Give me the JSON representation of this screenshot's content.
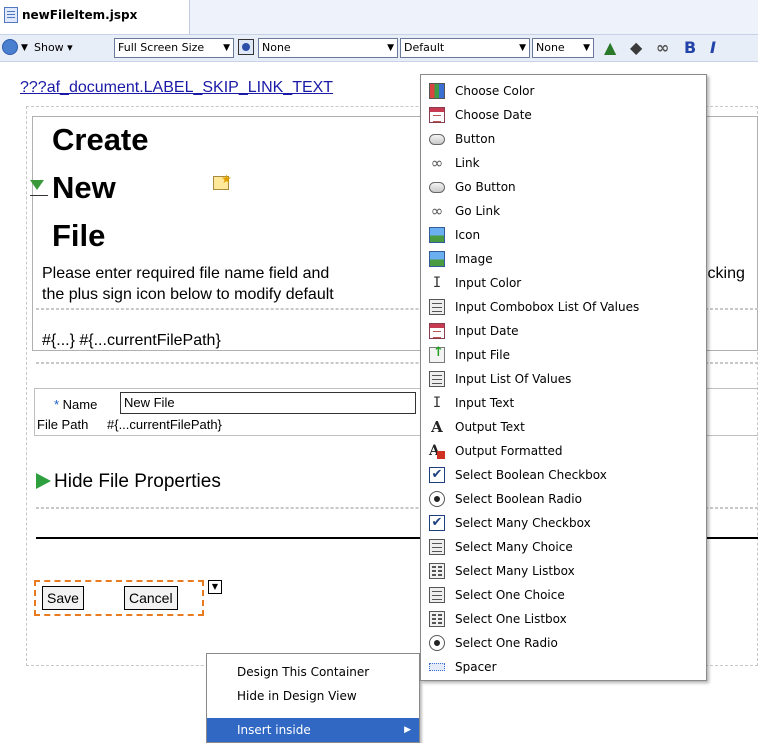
{
  "editor_tab": {
    "title": "newFileItem.jspx"
  },
  "toolbar": {
    "show_label": "Show",
    "screen_size": "Full Screen Size",
    "skin": "None",
    "style": "Default",
    "class": "None",
    "bold": "B",
    "italic": "I"
  },
  "page": {
    "skip_link": "???af_document.LABEL_SKIP_LINK_TEXT",
    "title_lines": [
      "Create",
      "New",
      "File"
    ],
    "instructions_line1": "Please enter required file name field and",
    "instructions_line1_tail": "icking",
    "instructions_line2": "the plus sign icon below to modify default",
    "path_expr": "#{...} #{...currentFilePath}",
    "name_label": "Name",
    "name_value": "New File",
    "file_path_label": "File Path",
    "file_path_value": "#{...currentFilePath}",
    "hide_props": "Hide File Properties",
    "save_button": "Save",
    "cancel_button": "Cancel"
  },
  "context_menu": {
    "items": [
      "Design This Container",
      "Hide in Design View",
      "Insert inside"
    ]
  },
  "insert_menu": {
    "items": [
      {
        "label": "Choose Color",
        "icon": "color-grid-icon"
      },
      {
        "label": "Choose Date",
        "icon": "calendar-icon"
      },
      {
        "label": "Button",
        "icon": "button-icon"
      },
      {
        "label": "Link",
        "icon": "link-icon"
      },
      {
        "label": "Go Button",
        "icon": "button-icon"
      },
      {
        "label": "Go Link",
        "icon": "link-icon"
      },
      {
        "label": "Icon",
        "icon": "image-icon"
      },
      {
        "label": "Image",
        "icon": "image-icon"
      },
      {
        "label": "Input Color",
        "icon": "text-cursor-icon"
      },
      {
        "label": "Input Combobox List Of Values",
        "icon": "list-icon"
      },
      {
        "label": "Input Date",
        "icon": "calendar-icon"
      },
      {
        "label": "Input File",
        "icon": "file-upload-icon"
      },
      {
        "label": "Input List Of Values",
        "icon": "list-icon"
      },
      {
        "label": "Input Text",
        "icon": "text-cursor-icon"
      },
      {
        "label": "Output Text",
        "icon": "letter-a-icon"
      },
      {
        "label": "Output Formatted",
        "icon": "formatted-text-icon"
      },
      {
        "label": "Select Boolean Checkbox",
        "icon": "checkbox-icon"
      },
      {
        "label": "Select Boolean Radio",
        "icon": "radio-icon"
      },
      {
        "label": "Select Many Checkbox",
        "icon": "checkbox-icon"
      },
      {
        "label": "Select Many Choice",
        "icon": "list-icon"
      },
      {
        "label": "Select Many Listbox",
        "icon": "listbox-icon"
      },
      {
        "label": "Select One Choice",
        "icon": "list-icon"
      },
      {
        "label": "Select One Listbox",
        "icon": "listbox-icon"
      },
      {
        "label": "Select One Radio",
        "icon": "radio-icon"
      },
      {
        "label": "Spacer",
        "icon": "spacer-icon"
      }
    ]
  }
}
